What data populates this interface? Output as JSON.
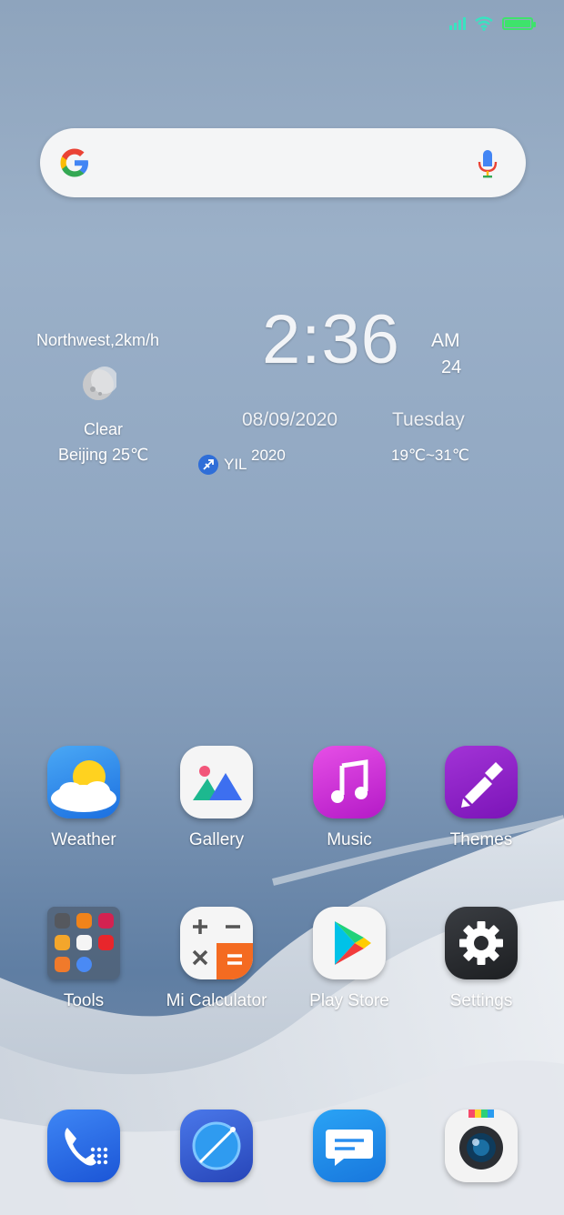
{
  "status": {
    "signal_icon": "signal-icon",
    "wifi_icon": "wifi-icon",
    "battery_icon": "battery-icon"
  },
  "search": {
    "logo": "google-g-icon",
    "mic": "mic-icon"
  },
  "weather_widget": {
    "wind": "Northwest,2km/h",
    "condition": "Clear",
    "location_temp": "Beijing 25℃",
    "time": "2:36",
    "ampm": "AM",
    "seconds": "24",
    "date": "08/09/2020",
    "weekday": "Tuesday",
    "year": "2020",
    "temp_range": "19℃~31℃",
    "zodiac_label": "YIL"
  },
  "apps": {
    "row1": [
      {
        "label": "Weather",
        "icon": "weather-icon"
      },
      {
        "label": "Gallery",
        "icon": "gallery-icon"
      },
      {
        "label": "Music",
        "icon": "music-icon"
      },
      {
        "label": "Themes",
        "icon": "themes-icon"
      }
    ],
    "row2": [
      {
        "label": "Tools",
        "icon": "tools-folder-icon"
      },
      {
        "label": "Mi Calculator",
        "icon": "calculator-icon"
      },
      {
        "label": "Play Store",
        "icon": "play-store-icon"
      },
      {
        "label": "Settings",
        "icon": "settings-icon"
      }
    ]
  },
  "dock": [
    {
      "icon": "phone-icon"
    },
    {
      "icon": "browser-icon"
    },
    {
      "icon": "messages-icon"
    },
    {
      "icon": "camera-icon"
    }
  ]
}
